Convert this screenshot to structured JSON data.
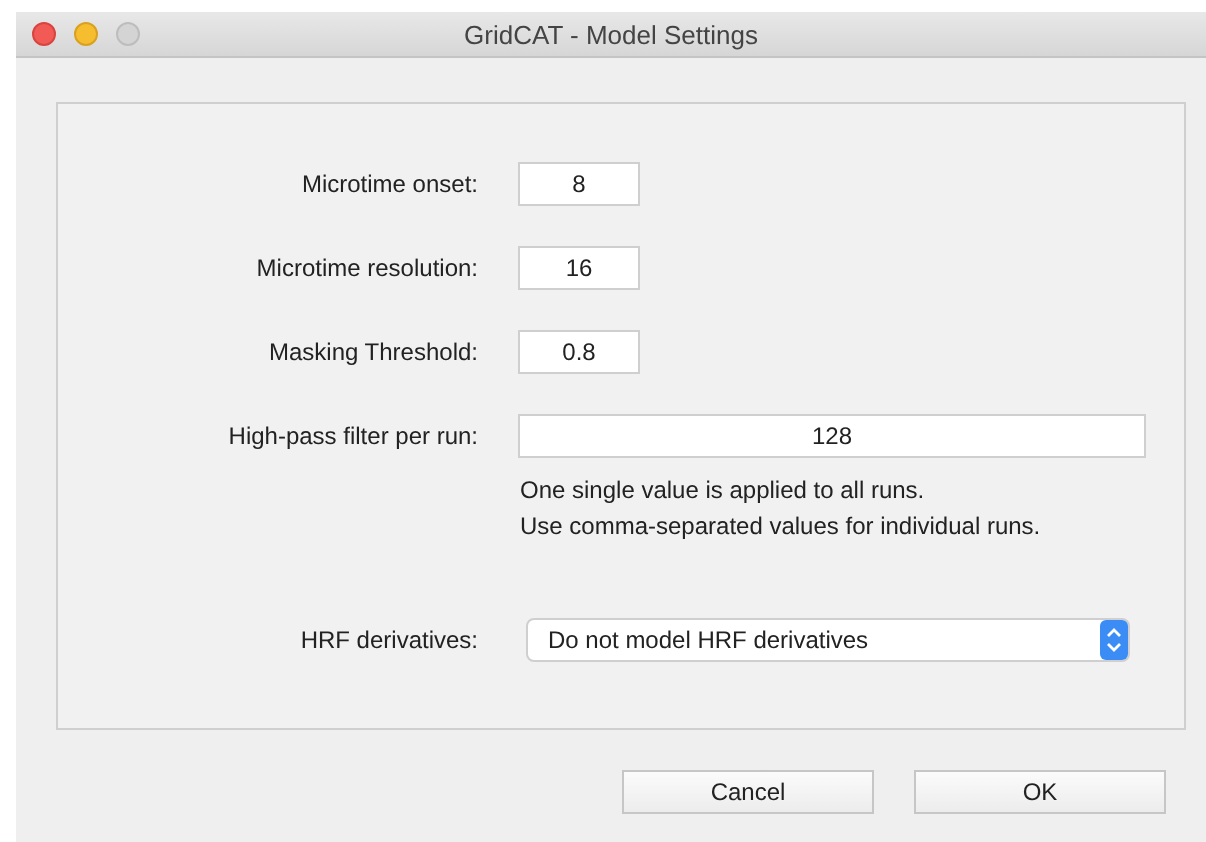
{
  "window": {
    "title": "GridCAT - Model Settings"
  },
  "fields": [
    {
      "label": "Microtime onset:",
      "value": "8",
      "kind": "short"
    },
    {
      "label": "Microtime resolution:",
      "value": "16",
      "kind": "short"
    },
    {
      "label": "Masking Threshold:",
      "value": "0.8",
      "kind": "short"
    },
    {
      "label": "High-pass filter per run:",
      "value": "128",
      "kind": "wide"
    }
  ],
  "help_lines": [
    "One single value is applied to all runs.",
    "Use comma-separated values for individual runs."
  ],
  "dropdown": {
    "label": "HRF derivatives:",
    "value": "Do not model HRF derivatives"
  },
  "buttons": [
    "Cancel",
    "OK"
  ]
}
